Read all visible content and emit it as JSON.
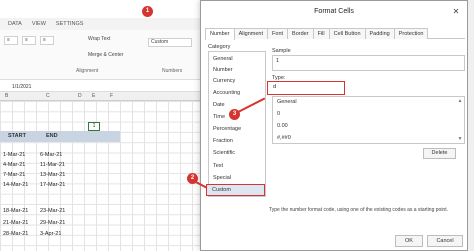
{
  "ribbon": {
    "tabs": [
      "DATA",
      "VIEW",
      "SETTINGS"
    ],
    "wrap_text": "Wrap Text",
    "merge_center": "Merge & Center",
    "alignment_label": "Alignment",
    "format_value": "Custom",
    "numbers_label": "Numbers"
  },
  "sheet": {
    "cell_ref": "1/1/2021",
    "columns": [
      "B",
      "C",
      "D",
      "E",
      "F"
    ],
    "selected_cell_value": "1",
    "header_start": "START",
    "header_end": "END",
    "start_dates": [
      "1-Mar-21",
      "4-Mar-21",
      "7-Mar-21",
      "14-Mar-21",
      "",
      "18-Mar-21",
      "21-Mar-21",
      "28-Mar-21"
    ],
    "end_dates": [
      "6-Mar-21",
      "11-Mar-21",
      "13-Mar-21",
      "17-Mar-21",
      "",
      "23-Mar-21",
      "29-Mar-21",
      "3-Apr-21"
    ]
  },
  "dialog": {
    "title": "Format Cells",
    "close_glyph": "✕",
    "tabs": [
      "Number",
      "Alignment",
      "Font",
      "Border",
      "Fill",
      "Cell Button",
      "Padding",
      "Protection"
    ],
    "category_label": "Category",
    "categories": [
      "General",
      "Number",
      "Currency",
      "Accounting",
      "Date",
      "Time",
      "Percentage",
      "Fraction",
      "Scientific",
      "Text",
      "Special",
      "Custom"
    ],
    "selected_category": "Custom",
    "sample_label": "Sample",
    "sample_value": "1",
    "type_label": "Type:",
    "type_value": "d",
    "type_options": [
      "General",
      "0",
      "0.00",
      "#,##0"
    ],
    "delete_label": "Delete",
    "hint": "Type the number format code, using one of the existing codes as a starting point.",
    "ok_label": "OK",
    "cancel_label": "Cancel"
  },
  "callouts": [
    "1",
    "2",
    "3"
  ],
  "colors": {
    "callout": "#d6342e",
    "selection": "#dde7f3",
    "header_row": "#c9d4e3"
  }
}
